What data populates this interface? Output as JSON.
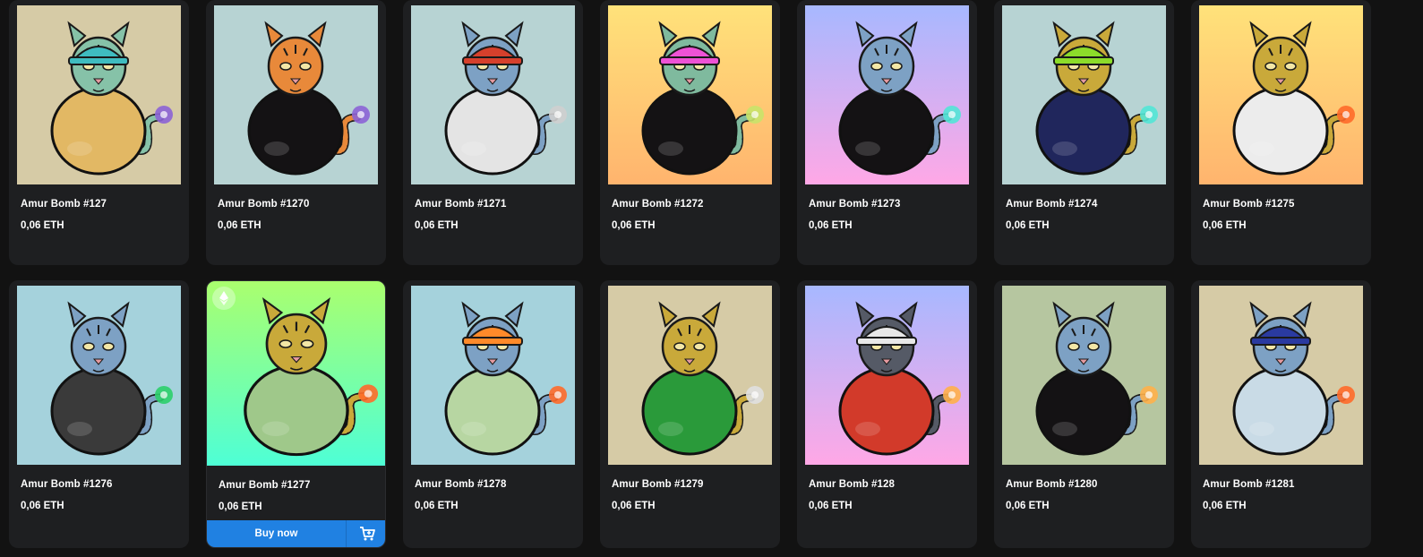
{
  "currency_symbol": "ETH",
  "cards": [
    {
      "title": "Amur Bomb #127",
      "price": "0,06 ETH",
      "bg_top": "#d6cba6",
      "bg_bottom": "#d6cba6",
      "fur": "#86c2a8",
      "hat": "#3fbcc0",
      "body": "#e2b864",
      "fuse": "#8c63d6"
    },
    {
      "title": "Amur Bomb #1270",
      "price": "0,06 ETH",
      "bg_top": "#b7d3d3",
      "bg_bottom": "#b7d3d3",
      "fur": "#e8893a",
      "hat": "",
      "body": "#141214",
      "fuse": "#8c63d6"
    },
    {
      "title": "Amur Bomb #1271",
      "price": "0,06 ETH",
      "bg_top": "#b7d3d3",
      "bg_bottom": "#b7d3d3",
      "fur": "#7da1c4",
      "hat": "#d6402c",
      "body": "#e4e4e4",
      "fuse": "#cfcfcf"
    },
    {
      "title": "Amur Bomb #1272",
      "price": "0,06 ETH",
      "bg_top": "#ffe27a",
      "bg_bottom": "#ffb46e",
      "fur": "#7fba9e",
      "hat": "#ee52d6",
      "body": "#141214",
      "fuse": "#c9e36a"
    },
    {
      "title": "Amur Bomb #1273",
      "price": "0,06 ETH",
      "bg_top": "#a7b8ff",
      "bg_bottom": "#ffa8e6",
      "fur": "#7da1c4",
      "hat": "",
      "body": "#141214",
      "fuse": "#52e5d6"
    },
    {
      "title": "Amur Bomb #1274",
      "price": "0,06 ETH",
      "bg_top": "#b7d3d3",
      "bg_bottom": "#b7d3d3",
      "fur": "#c9a93a",
      "hat": "#8cdc2a",
      "body": "#20265c",
      "fuse": "#52e5d6"
    },
    {
      "title": "Amur Bomb #1275",
      "price": "0,06 ETH",
      "bg_top": "#ffe27a",
      "bg_bottom": "#ffb46e",
      "fur": "#c9a93a",
      "hat": "",
      "body": "#ececec",
      "fuse": "#ff6a2a"
    },
    {
      "title": "Amur Bomb #1276",
      "price": "0,06 ETH",
      "bg_top": "#a5d2dc",
      "bg_bottom": "#a5d2dc",
      "fur": "#7da1c4",
      "hat": "",
      "body": "#3a3a3a",
      "fuse": "#2ccf6a"
    },
    {
      "title": "Amur Bomb #1277",
      "price": "0,06 ETH",
      "bg_top": "#aaff6e",
      "bg_bottom": "#4effd6",
      "fur": "#c9a93a",
      "hat": "",
      "body": "#9fc88a",
      "fuse": "#ff6a2a"
    },
    {
      "title": "Amur Bomb #1278",
      "price": "0,06 ETH",
      "bg_top": "#a5d2dc",
      "bg_bottom": "#a5d2dc",
      "fur": "#7da1c4",
      "hat": "#ff8a2a",
      "body": "#b7d6a2",
      "fuse": "#ff6a2a"
    },
    {
      "title": "Amur Bomb #1279",
      "price": "0,06 ETH",
      "bg_top": "#d6cba6",
      "bg_bottom": "#d6cba6",
      "fur": "#c9a93a",
      "hat": "",
      "body": "#2a9a3a",
      "fuse": "#e0e0e0"
    },
    {
      "title": "Amur Bomb #128",
      "price": "0,06 ETH",
      "bg_top": "#a7b8ff",
      "bg_bottom": "#ffa8e6",
      "fur": "#555a66",
      "hat": "#e8e8e8",
      "body": "#d23a2a",
      "fuse": "#ffb04a"
    },
    {
      "title": "Amur Bomb #1280",
      "price": "0,06 ETH",
      "bg_top": "#b6c6a0",
      "bg_bottom": "#b6c6a0",
      "fur": "#7da1c4",
      "hat": "",
      "body": "#141214",
      "fuse": "#ffb04a"
    },
    {
      "title": "Amur Bomb #1281",
      "price": "0,06 ETH",
      "bg_top": "#d6cba6",
      "bg_bottom": "#d6cba6",
      "fur": "#7da1c4",
      "hat": "#2a3aa0",
      "body": "#c9dbe6",
      "fuse": "#ff6a2a"
    }
  ],
  "hovered_card": {
    "buy_label": "Buy now",
    "buy_icon": "cart-icon",
    "badge_icon": "ethereum-icon"
  }
}
